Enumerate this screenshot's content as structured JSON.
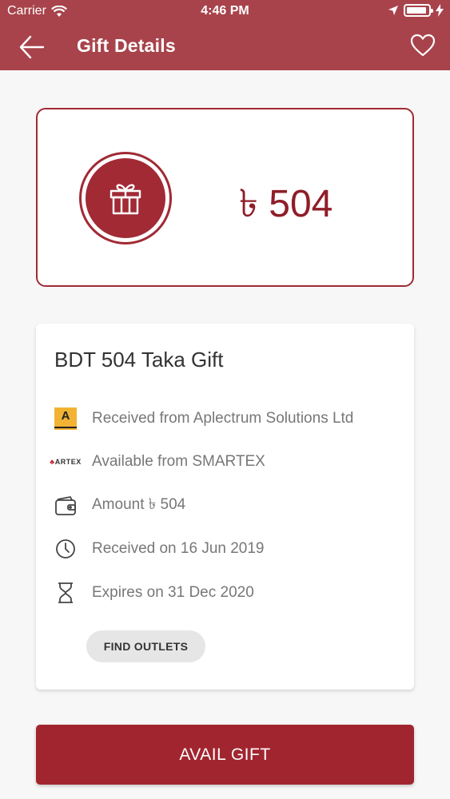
{
  "status_bar": {
    "carrier": "Carrier",
    "time": "4:46 PM"
  },
  "nav": {
    "title": "Gift Details",
    "back_icon": "arrow-left-icon",
    "favorite_icon": "heart-icon"
  },
  "value_card": {
    "amount": "৳ 504",
    "icon": "gift-icon"
  },
  "details": {
    "title": "BDT 504 Taka Gift",
    "received_from_logo": "A",
    "store_logo": "ARTEX",
    "rows": [
      {
        "icon": "aplectrum-logo",
        "text": "Received from Aplectrum Solutions Ltd"
      },
      {
        "icon": "smartex-logo",
        "text": "Available from SMARTEX"
      },
      {
        "icon": "wallet-icon",
        "text": "Amount ৳ 504"
      },
      {
        "icon": "clock-icon",
        "text": "Received on 16 Jun 2019"
      },
      {
        "icon": "hourglass-icon",
        "text": "Expires on 31 Dec 2020"
      }
    ],
    "find_outlets_label": "FIND OUTLETS"
  },
  "avail_label": "AVAIL GIFT",
  "colors": {
    "header": "#a8434b",
    "accent": "#a12a35",
    "amount_text": "#8f1d28",
    "button": "#a1252f"
  }
}
